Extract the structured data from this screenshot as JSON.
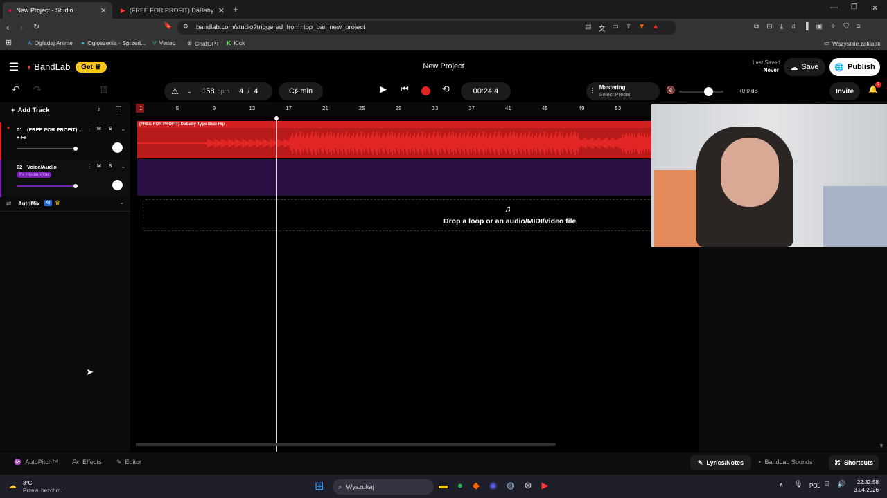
{
  "browser": {
    "tabs": [
      {
        "title": "New Project - Studio"
      },
      {
        "title": "(FREE FOR PROFIT) DaBaby Type Beat"
      }
    ],
    "url": "bandlab.com/studio?triggered_from=top_bar_new_project",
    "bookmarks": [
      "Oglądaj Anime",
      "Ogłoszenia - Sprzed...",
      "Vinted",
      "ChatGPT",
      "Kick"
    ],
    "all_bookmarks": "Wszystkie zakładki"
  },
  "app": {
    "brand": "BandLab",
    "get_label": "Get",
    "project_title": "New Project",
    "last_saved_label": "Last Saved",
    "last_saved_value": "Never",
    "save_label": "Save",
    "publish_label": "Publish",
    "invite_label": "Invite",
    "notification_count": "1",
    "bpm_value": "158",
    "bpm_unit": "bpm",
    "time_sig_num": "4",
    "time_sig_sep": "/",
    "time_sig_den": "4",
    "key": "C♯ min",
    "time": "00:24.4",
    "mastering_label": "Mastering",
    "mastering_preset": "Select Preset",
    "volume_db": "+0.0 dB",
    "add_track_label": "Add Track",
    "ruler": [
      "1",
      "5",
      "9",
      "13",
      "17",
      "21",
      "25",
      "29",
      "33",
      "37",
      "41",
      "45",
      "49",
      "53"
    ],
    "tracks": [
      {
        "number": "01",
        "name": "(FREE FOR PROFIT) ...",
        "fx": "+ Fx",
        "clip": "(FREE FOR PROFIT) DaBaby Type Beat  Hip",
        "color": "#e02424"
      },
      {
        "number": "02",
        "name": "Voice/Audio",
        "fx": "Fx Hippie Vibe",
        "clip": "",
        "color": "#7a1fb8"
      }
    ],
    "mute": "M",
    "solo": "S",
    "automix_label": "AutoMix",
    "ai_badge": "AI",
    "drop_text": "Drop a loop or an audio/MIDI/video file",
    "bottom": {
      "autopitch": "AutoPitch™",
      "effects": "Effects",
      "editor": "Editor",
      "lyrics": "Lyrics/Notes",
      "sounds": "BandLab Sounds",
      "shortcuts": "Shortcuts"
    }
  },
  "taskbar": {
    "temp": "3°C",
    "weather": "Przew. bezchm.",
    "search": "Wyszukaj",
    "lang": "POL",
    "time": "22:32:58",
    "date": "3.04.2026"
  }
}
